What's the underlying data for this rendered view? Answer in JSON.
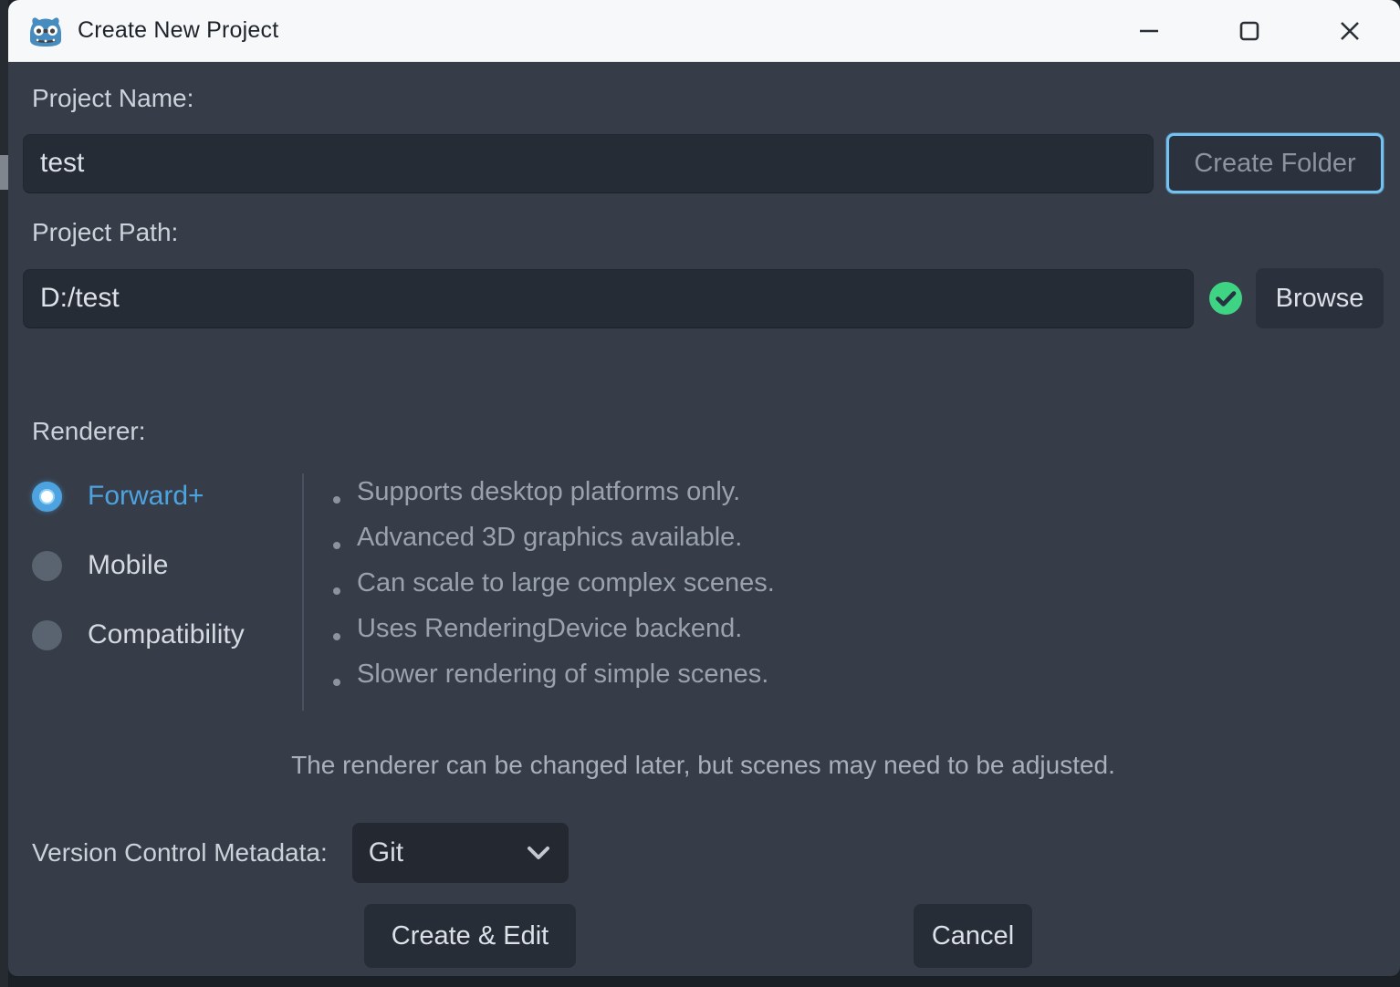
{
  "window": {
    "title": "Create New Project",
    "app_icon": "godot-logo"
  },
  "project_name": {
    "label": "Project Name:",
    "value": "test",
    "create_folder_label": "Create Folder"
  },
  "project_path": {
    "label": "Project Path:",
    "value": "D:/test",
    "status": "valid",
    "browse_label": "Browse"
  },
  "renderer": {
    "label": "Renderer:",
    "options": [
      {
        "label": "Forward+",
        "selected": true
      },
      {
        "label": "Mobile",
        "selected": false
      },
      {
        "label": "Compatibility",
        "selected": false
      }
    ],
    "bullets": [
      "Supports desktop platforms only.",
      "Advanced 3D graphics available.",
      "Can scale to large complex scenes.",
      "Uses RenderingDevice backend.",
      "Slower rendering of simple scenes."
    ],
    "note": "The renderer can be changed later, but scenes may need to be adjusted."
  },
  "version_control": {
    "label": "Version Control Metadata:",
    "selected_option": "Git"
  },
  "actions": {
    "create_edit_label": "Create & Edit",
    "cancel_label": "Cancel"
  },
  "colors": {
    "dialog_background": "#363d49",
    "titlebar_background": "#f7f8fa",
    "field_background": "#262c36",
    "accent_blue": "#4da3e0",
    "focus_border_blue": "#72c2f2",
    "success_green": "#3fd384",
    "muted_text": "#9aa2ad"
  }
}
